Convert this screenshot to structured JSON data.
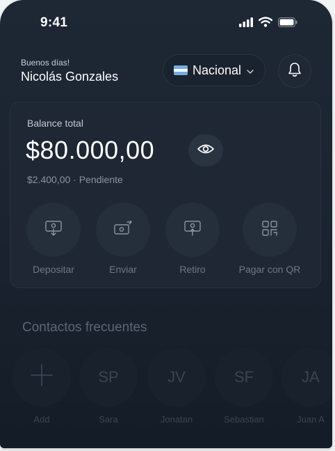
{
  "status_bar": {
    "time": "9:41"
  },
  "header": {
    "greeting": "Buenos días!",
    "user_name": "Nicolás Gonzales",
    "region_label": "Nacional",
    "flag_colors": [
      "#74acdf",
      "#ffffff",
      "#74acdf"
    ]
  },
  "balance": {
    "label": "Balance total",
    "amount": "$80.000,00",
    "pending": "$2.400,00 · Pendiente"
  },
  "actions": [
    {
      "label": "Depositar",
      "icon": "deposit-icon"
    },
    {
      "label": "Enviar",
      "icon": "send-icon"
    },
    {
      "label": "Retiro",
      "icon": "withdraw-icon"
    },
    {
      "label": "Pagar con QR",
      "icon": "qr-icon"
    }
  ],
  "contacts": {
    "title": "Contactos frecuentes",
    "items": [
      {
        "initials": "+",
        "label": "Add"
      },
      {
        "initials": "SP",
        "label": "Sara"
      },
      {
        "initials": "JV",
        "label": "Jonatan"
      },
      {
        "initials": "SF",
        "label": "Sebastian"
      },
      {
        "initials": "JA",
        "label": "Juan A"
      }
    ]
  },
  "colors": {
    "background": "#1b2430",
    "card": "#1e2733",
    "text_primary": "#ffffff",
    "text_muted": "#8b94a1"
  }
}
